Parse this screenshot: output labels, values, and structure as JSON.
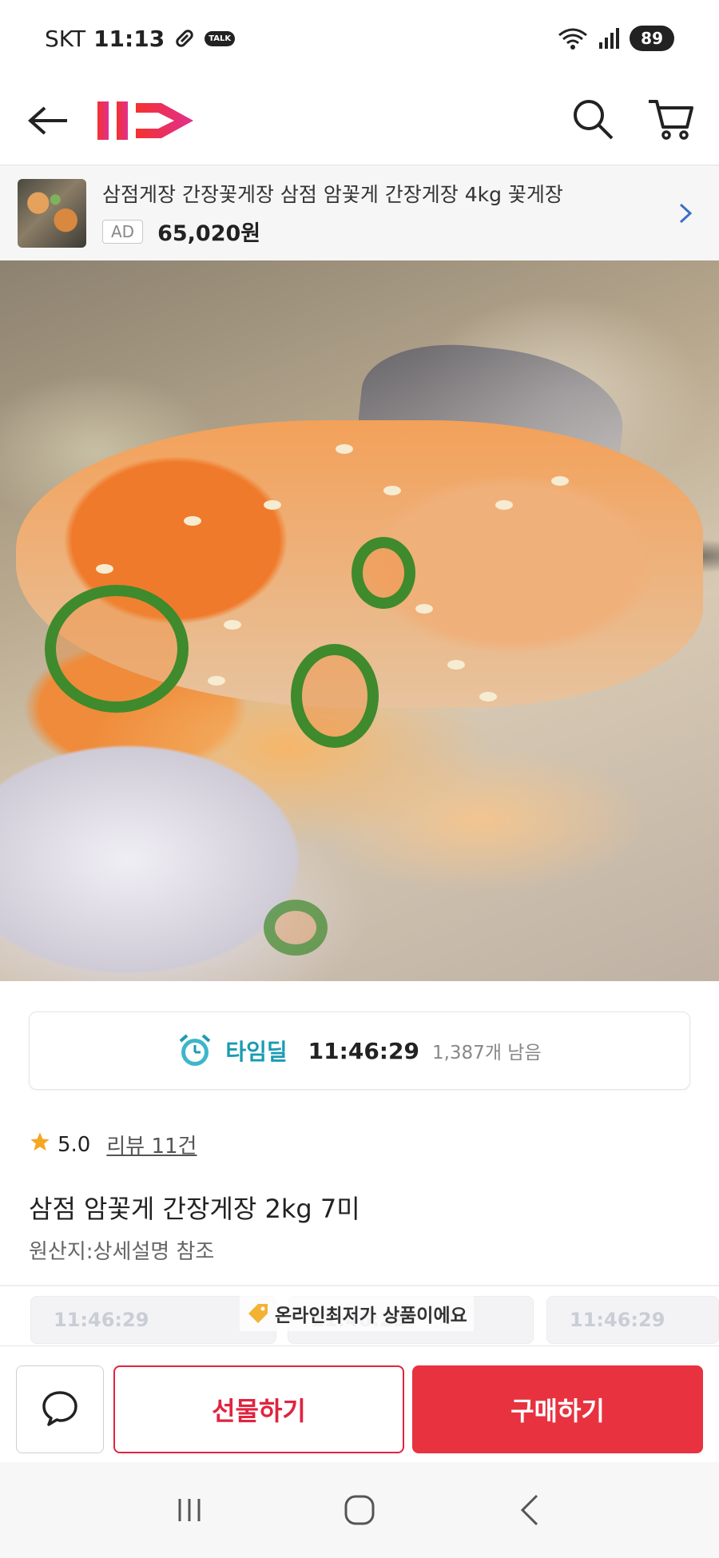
{
  "status_bar": {
    "carrier": "SKT",
    "time": "11:13",
    "talk_badge": "TALK",
    "battery": "89",
    "icons": [
      "link-icon",
      "wifi-icon",
      "signal-icon"
    ]
  },
  "nav": {
    "logo": "11",
    "icons": [
      "back-arrow-icon",
      "search-icon",
      "cart-icon"
    ]
  },
  "ad_banner": {
    "title": "삼점게장 간장꽃게장 삼점 암꽃게 간장게장 4kg 꽃게장",
    "label": "AD",
    "price": "65,020원"
  },
  "timedeal": {
    "label": "타임딜",
    "time": "11:46:29",
    "remaining": "1,387개 남음"
  },
  "rating": {
    "score": "5.0",
    "reviews": "리뷰 11건"
  },
  "product": {
    "title": "삼점 암꽃게 간장게장 2kg 7미",
    "origin": "원산지:상세설명 참조"
  },
  "strip": {
    "badge": "온라인최저가 상품이에요",
    "card_time": "11:46:29"
  },
  "actions": {
    "gift": "선물하기",
    "buy": "구매하기"
  },
  "colors": {
    "brand_red": "#e8323f",
    "timedeal_teal": "#1b9bb3",
    "star": "#f5a623"
  }
}
